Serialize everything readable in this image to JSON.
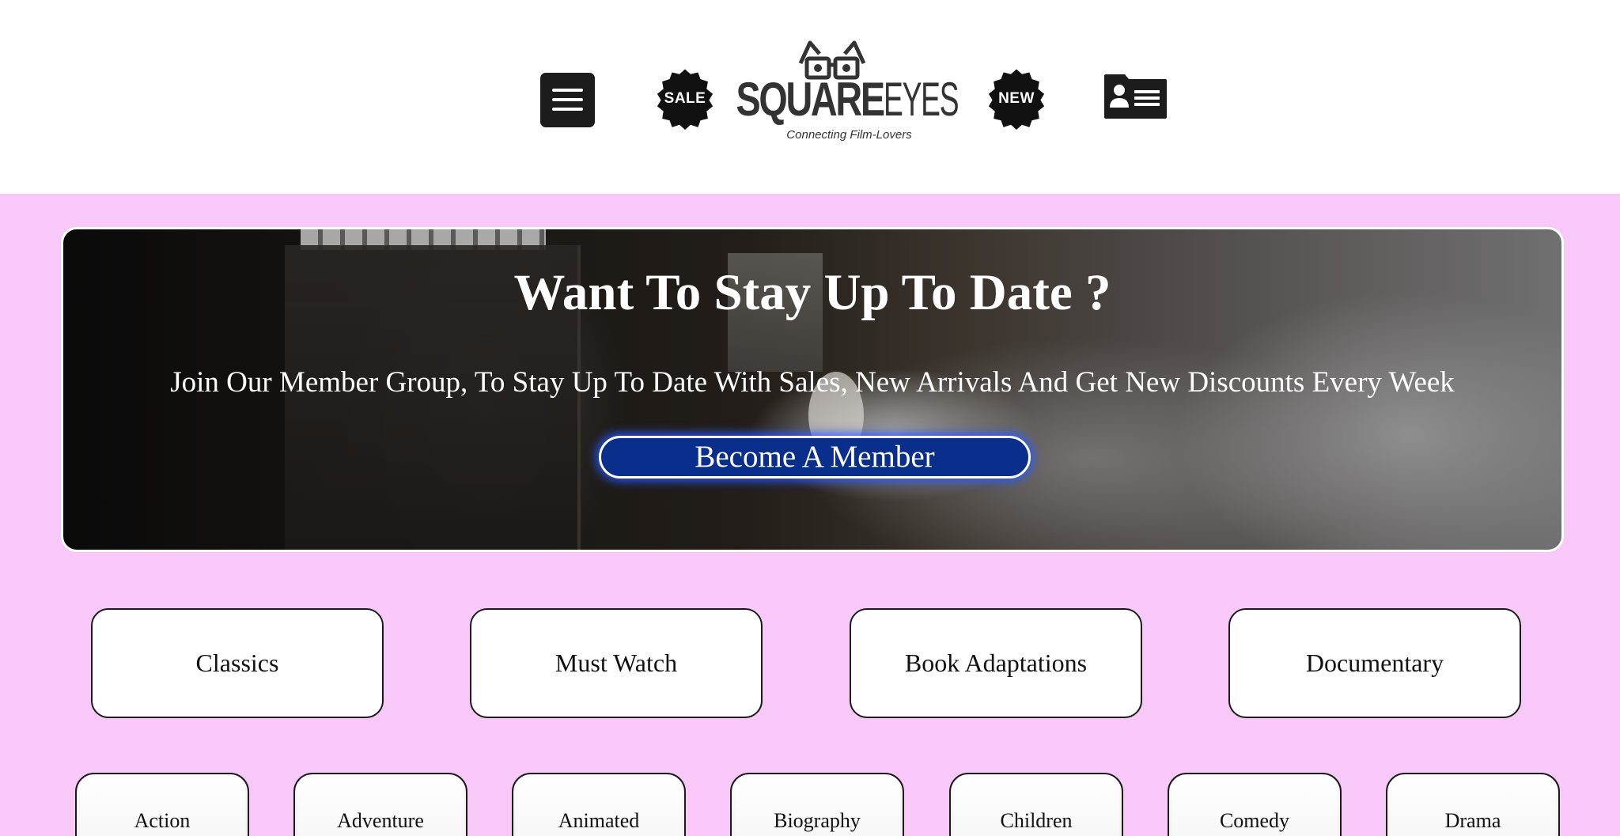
{
  "header": {
    "menu_icon": "hamburger-menu-icon",
    "sale_badge": "SALE",
    "new_badge": "NEW",
    "account_icon": "member-card-icon",
    "logo": {
      "square": "SQUARE",
      "eyes": "EYES",
      "tagline": "Connecting Film-Lovers"
    }
  },
  "hero": {
    "title": "Want To Stay Up To Date ?",
    "text": "Join Our Member Group, To Stay Up To Date With Sales, New Arrivals And Get New Discounts Every Week",
    "button_label": "Become A Member"
  },
  "categories": [
    "Classics",
    "Must Watch",
    "Book Adaptations",
    "Documentary"
  ],
  "genres": [
    "Action",
    "Adventure",
    "Animated",
    "Biography",
    "Children",
    "Comedy",
    "Drama"
  ],
  "colors": {
    "page_background": "#f8c8f8",
    "header_background": "#ffffff",
    "member_button": "#0a2e8c",
    "icon_dark": "#1c1c1c"
  }
}
